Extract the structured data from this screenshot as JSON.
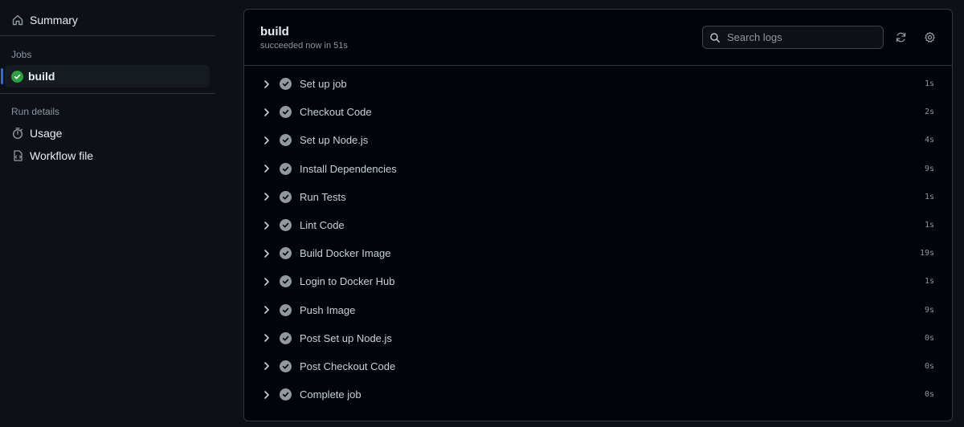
{
  "sidebar": {
    "summary_label": "Summary",
    "jobs_heading": "Jobs",
    "job_label": "build",
    "run_details_heading": "Run details",
    "usage_label": "Usage",
    "workflow_file_label": "Workflow file"
  },
  "job": {
    "title": "build",
    "status_text": "succeeded now in 51s"
  },
  "search": {
    "placeholder": "Search logs"
  },
  "steps": [
    {
      "name": "Set up job",
      "duration": "1s"
    },
    {
      "name": "Checkout Code",
      "duration": "2s"
    },
    {
      "name": "Set up Node.js",
      "duration": "4s"
    },
    {
      "name": "Install Dependencies",
      "duration": "9s"
    },
    {
      "name": "Run Tests",
      "duration": "1s"
    },
    {
      "name": "Lint Code",
      "duration": "1s"
    },
    {
      "name": "Build Docker Image",
      "duration": "19s"
    },
    {
      "name": "Login to Docker Hub",
      "duration": "1s"
    },
    {
      "name": "Push Image",
      "duration": "9s"
    },
    {
      "name": "Post Set up Node.js",
      "duration": "0s"
    },
    {
      "name": "Post Checkout Code",
      "duration": "0s"
    },
    {
      "name": "Complete job",
      "duration": "0s"
    }
  ],
  "colors": {
    "background": "#0d1117",
    "panel": "#010409",
    "success": "#2ea043",
    "accent": "#1f6feb",
    "muted_check": "#9198a1"
  },
  "icons": {
    "summary": "home-icon",
    "job_status": "check-circle-icon",
    "usage": "stopwatch-icon",
    "workflow_file": "file-code-icon",
    "search": "search-icon",
    "refresh": "sync-icon",
    "settings": "gear-icon",
    "step_expand": "chevron-right-icon",
    "step_status": "check-circle-icon"
  }
}
